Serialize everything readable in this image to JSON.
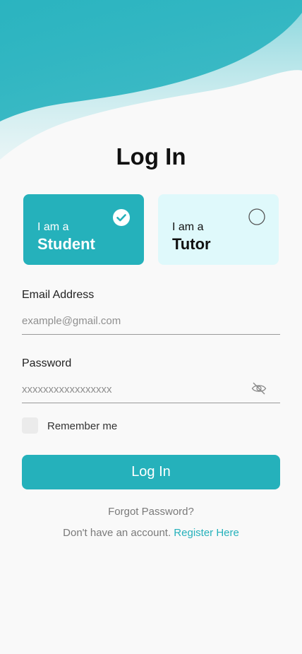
{
  "page": {
    "title": "Log In"
  },
  "roles": {
    "student": {
      "prefix": "I am a",
      "name": "Student",
      "selected": true
    },
    "tutor": {
      "prefix": "I am a",
      "name": "Tutor",
      "selected": false
    }
  },
  "form": {
    "email_label": "Email Address",
    "email_placeholder": "example@gmail.com",
    "password_label": "Password",
    "password_placeholder": "xxxxxxxxxxxxxxxxx",
    "remember_label": "Remember me",
    "login_button": "Log In",
    "forgot_password": "Forgot Password?",
    "no_account_text": "Don't have an account.",
    "register_link": "Register Here"
  },
  "colors": {
    "accent": "#25b1bb",
    "accent_light": "#dff9fb",
    "background": "#f9f9f9"
  },
  "icons": {
    "selected": "check-circle-icon",
    "unselected": "radio-circle-icon",
    "password_toggle": "eye-slash-icon"
  }
}
